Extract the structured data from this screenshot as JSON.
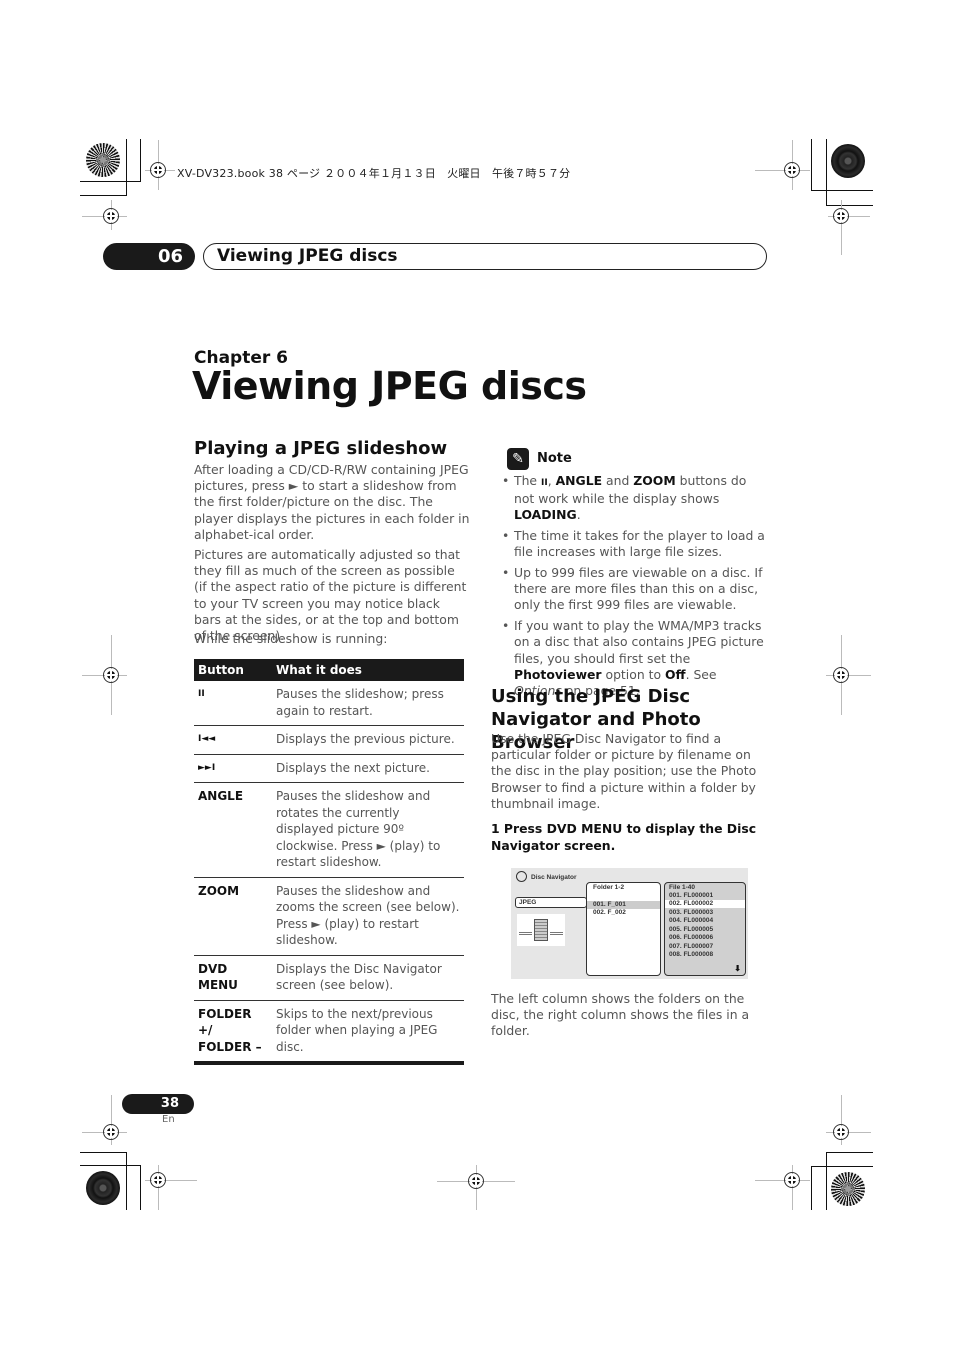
{
  "print_header": {
    "file_info": "XV-DV323.book  38 ページ  ２００４年１月１３日　火曜日　午後７時５７分"
  },
  "running_header": {
    "chapter_number": "06",
    "chapter_title": "Viewing JPEG discs"
  },
  "chapter": {
    "label": "Chapter 6",
    "title": "Viewing JPEG discs"
  },
  "section_slideshow": {
    "heading": "Playing a JPEG slideshow",
    "para1": "After loading a CD/CD-R/RW containing JPEG pictures, press ► to start a slideshow from the first folder/picture on the disc. The player displays the pictures in each folder in alphabet-ical order.",
    "para2": "Pictures are automatically adjusted so that they fill as much of the screen as possible (if the aspect ratio of the picture is different to your TV screen you may notice black bars at the sides, or at the top and bottom of the screen).",
    "para3": "While the slideshow is running:",
    "table": {
      "headers": [
        "Button",
        "What it does"
      ],
      "rows": [
        {
          "button": "II",
          "action": "Pauses the slideshow; press again to restart."
        },
        {
          "button": "I◄◄",
          "action": "Displays the previous picture."
        },
        {
          "button": "►►I",
          "action": "Displays the next picture."
        },
        {
          "button": "ANGLE",
          "action": "Pauses the slideshow and rotates the currently displayed picture 90º clockwise. Press ► (play) to restart slideshow."
        },
        {
          "button": "ZOOM",
          "action": "Pauses the slideshow and zooms the screen (see below). Press ► (play) to restart slideshow."
        },
        {
          "button": "DVD MENU",
          "action": "Displays the Disc Navigator screen (see below)."
        },
        {
          "button": "FOLDER +/ FOLDER –",
          "action": "Skips to the next/previous folder when playing a JPEG disc."
        }
      ]
    }
  },
  "note": {
    "icon": "pencil-icon",
    "title": "Note",
    "items": [
      {
        "parts": [
          "The ",
          "II",
          ", ",
          "ANGLE",
          " and ",
          "ZOOM",
          " buttons do not work while the display shows ",
          "LOADING",
          "."
        ]
      },
      {
        "text": "The time it takes for the player to load a file increases with large file sizes."
      },
      {
        "text": "Up to 999 files are viewable on a disc. If there are more files than this on a disc, only the first 999 files are viewable."
      },
      {
        "parts": [
          "If you want to play the WMA/MP3 tracks on a disc that also contains JPEG picture files, you should first set the ",
          "Photoviewer",
          " option to ",
          "Off",
          ". See ",
          "Options",
          " on page 51."
        ]
      }
    ]
  },
  "section_navigator": {
    "heading": "Using the JPEG Disc Navigator and Photo Browser",
    "para1": "Use the JPEG Disc Navigator to find a particular folder or picture by filename on the disc in the play position; use the Photo Browser to find a picture within a folder by thumbnail image.",
    "step1": "1    Press DVD MENU to display the Disc Navigator screen.",
    "para2": "The left column shows the folders on the disc, the right column shows the files in a folder."
  },
  "disc_navigator_screen": {
    "title": "Disc Navigator",
    "media_type": "JPEG",
    "folder_header": "Folder 1-2",
    "folders": [
      "001. F_001",
      "002. F_002"
    ],
    "selected_folder_index": 0,
    "file_header": "File 1-40",
    "files": [
      "001. FL000001",
      "002. FL000002",
      "003. FL000003",
      "004. FL000004",
      "005. FL000005",
      "006. FL000006",
      "007. FL000007",
      "008. FL000008"
    ],
    "selected_file_index": 1,
    "scroll_icon": "arrow-down-icon"
  },
  "footer": {
    "page_number": "38",
    "language": "En"
  }
}
